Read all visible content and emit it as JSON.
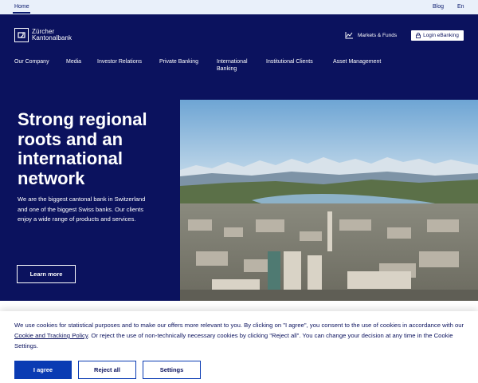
{
  "topbar": {
    "home": "Home",
    "blog": "Blog",
    "lang": "En"
  },
  "header": {
    "logo_line1": "Zürcher",
    "logo_line2": "Kantonalbank",
    "markets": "Markets & Funds",
    "ebanking": "Login eBanking"
  },
  "nav": {
    "our_company": "Our Company",
    "media": "Media",
    "investor_relations": "Investor Relations",
    "private_banking": "Private Banking",
    "international_line1": "International",
    "international_line2": "Banking",
    "institutional_clients": "Institutional Clients",
    "asset_management": "Asset Management"
  },
  "hero": {
    "title": "Strong regional roots and an international network",
    "text": "We are the biggest cantonal bank in Switzerland and one of the biggest Swiss banks. Our clients enjoy a wide range of products and services.",
    "cta": "Learn more"
  },
  "cookie": {
    "text_before": "We use cookies for statistical purposes and to make our offers more relevant to you. By clicking on \"I agree\", you consent to the use of cookies in accordance with our ",
    "link": "Cookie and Tracking Policy",
    "text_after": ". Or reject the use of non-technically necessary cookies by clicking \"Reject all\". You can change your decision at any time in the Cookie Settings.",
    "agree": "I agree",
    "reject": "Reject all",
    "settings": "Settings"
  },
  "colors": {
    "navy": "#0b125e",
    "accent": "#0a3bb3",
    "topbar": "#e9f0fa"
  }
}
